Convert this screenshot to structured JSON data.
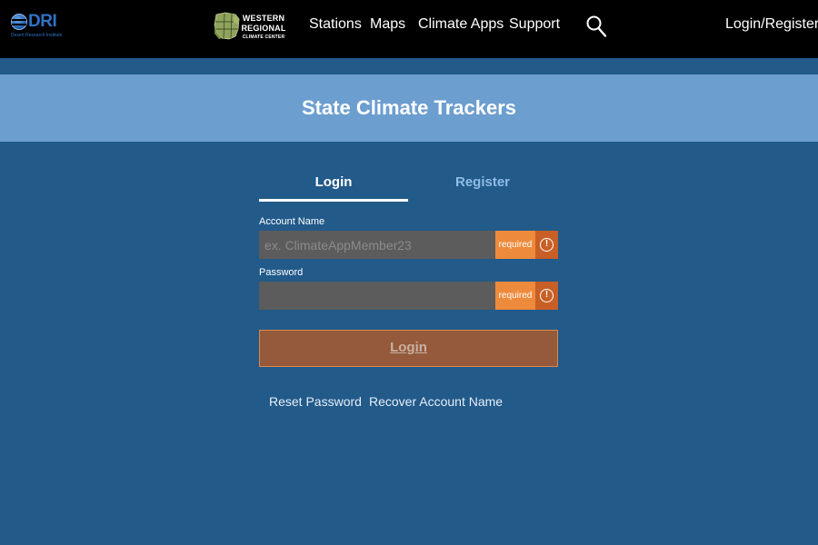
{
  "nav": {
    "dri_logo_text": "DRI",
    "dri_logo_subtext": "Desert Research Institute",
    "wrcc_logo_line1": "WESTERN",
    "wrcc_logo_line2": "REGIONAL",
    "wrcc_logo_line3": "CLIMATE CENTER",
    "links": [
      "Stations",
      "Maps",
      "Climate Apps",
      "Support"
    ],
    "search_icon": "search-icon",
    "login_register": "Login/Register"
  },
  "banner": {
    "title": "State Climate Trackers"
  },
  "tabs": {
    "login": "Login",
    "register": "Register",
    "active": "login"
  },
  "form": {
    "account_name_label": "Account Name",
    "account_name_placeholder": "ex. ClimateAppMember23",
    "account_name_value": "",
    "password_label": "Password",
    "password_value": "",
    "required_label": "required",
    "alert_icon": "!",
    "login_button": "Login"
  },
  "links": {
    "reset_password": "Reset Password",
    "recover_account": "Recover Account Name"
  },
  "colors": {
    "nav_bg": "#000000",
    "page_bg": "#225a8a",
    "banner_bg": "#6c9ecf",
    "input_bg": "#5c5c5c",
    "required_bg": "#ee8a3c",
    "alert_bg": "#c85f26",
    "login_button_bg": "#955a3b"
  }
}
